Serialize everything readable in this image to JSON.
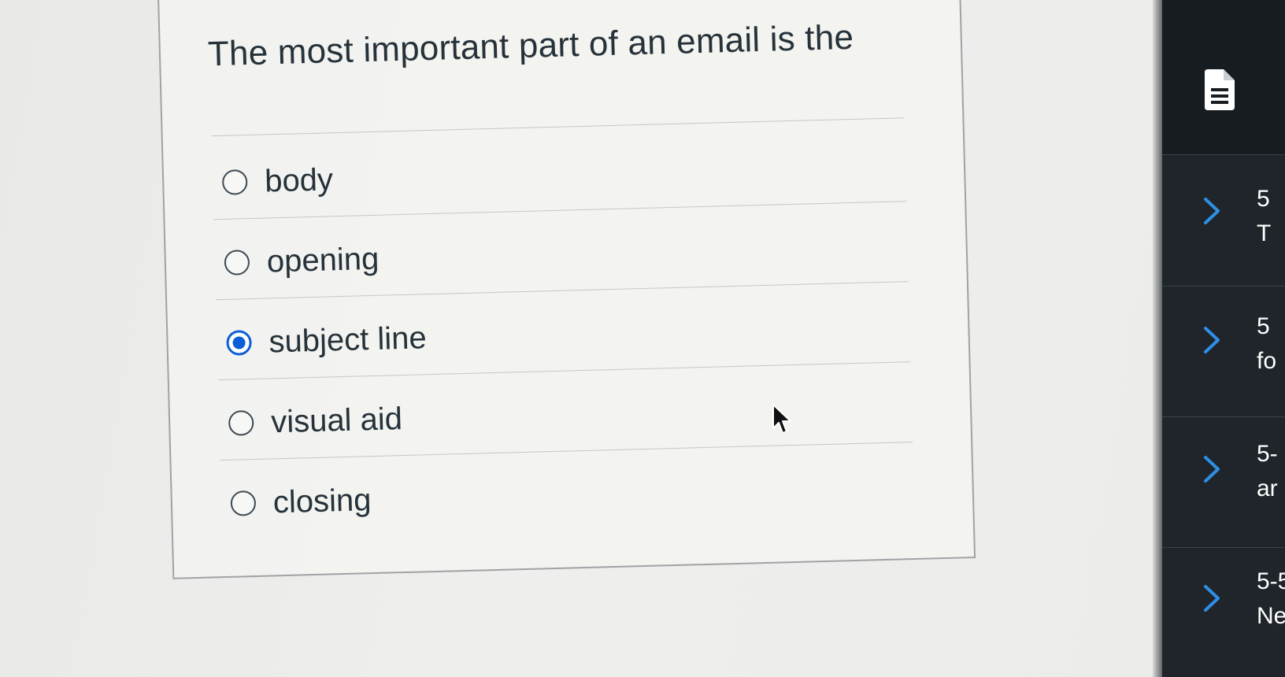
{
  "question": {
    "prompt": "The most important part of an email is the",
    "answers": [
      {
        "label": "body",
        "selected": false
      },
      {
        "label": "opening",
        "selected": false
      },
      {
        "label": "subject line",
        "selected": true
      },
      {
        "label": "visual aid",
        "selected": false
      },
      {
        "label": "closing",
        "selected": false
      }
    ]
  },
  "sidebar": {
    "header_icon": "document-icon",
    "items": [
      {
        "line1": "5",
        "line2": "T",
        "icon": "chevron-right-icon"
      },
      {
        "line1": "5",
        "line2": "fo",
        "icon": "chevron-right-icon"
      },
      {
        "line1": "5-",
        "line2": "ar",
        "icon": "chevron-right-icon"
      },
      {
        "line1": "5-5",
        "line2": "Ne",
        "icon": "chevron-right-icon"
      }
    ]
  },
  "colors": {
    "selected_radio": "#0a5ed8",
    "sidebar_bg": "#1f252a",
    "chevron": "#2e8fe6"
  }
}
